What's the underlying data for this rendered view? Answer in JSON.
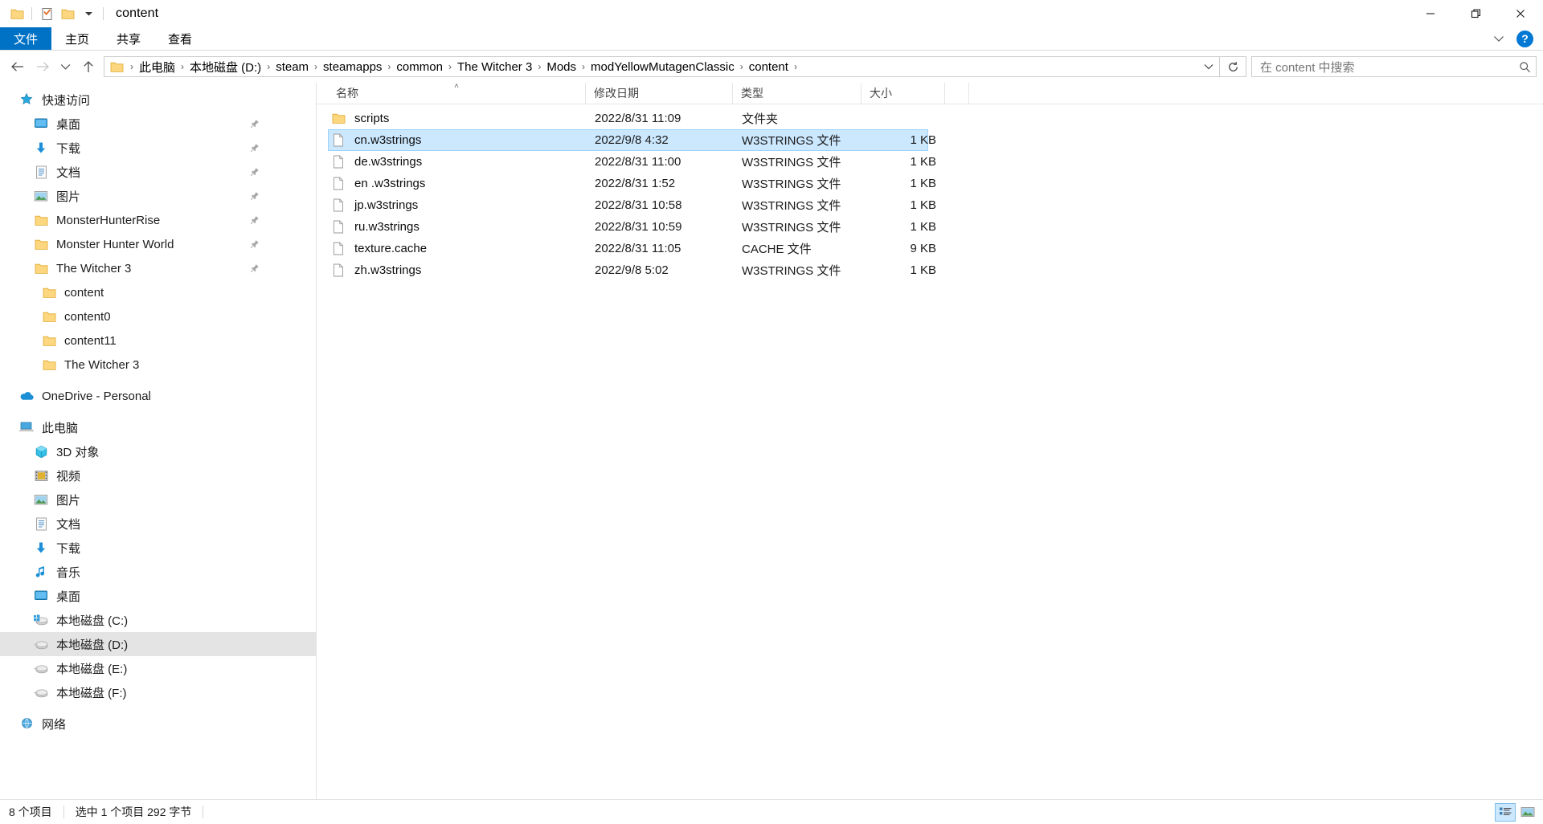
{
  "window": {
    "title": "content",
    "quick_access": [
      {
        "name": "folder-icon",
        "label": "文件夹"
      },
      {
        "name": "properties-icon",
        "label": "属性"
      },
      {
        "name": "new-folder-icon",
        "label": "新建文件夹"
      }
    ],
    "controls": {
      "minimize": "—",
      "maximize": "❐",
      "close": "✕"
    }
  },
  "ribbon": {
    "tabs": [
      {
        "label": "文件",
        "active": true
      },
      {
        "label": "主页",
        "active": false
      },
      {
        "label": "共享",
        "active": false
      },
      {
        "label": "查看",
        "active": false
      }
    ],
    "collapse_label": "展开功能区",
    "help_label": "?"
  },
  "address": {
    "back_label": "返回",
    "forward_label": "前进",
    "recent_label": "最近位置",
    "up_label": "上移",
    "breadcrumbs": [
      "此电脑",
      "本地磁盘 (D:)",
      "steam",
      "steamapps",
      "common",
      "The Witcher 3",
      "Mods",
      "modYellowMutagenClassic",
      "content"
    ],
    "separator": "›",
    "refresh_label": "刷新",
    "dropdown_label": "下拉"
  },
  "search": {
    "placeholder": "在 content 中搜索",
    "value": ""
  },
  "sidebar": {
    "groups": [
      {
        "header": {
          "label": "快速访问",
          "icon": "star-icon",
          "level": 0
        },
        "items": [
          {
            "label": "桌面",
            "icon": "desktop-icon",
            "level": 1,
            "pinned": true
          },
          {
            "label": "下载",
            "icon": "download-icon",
            "level": 1,
            "pinned": true
          },
          {
            "label": "文档",
            "icon": "documents-icon",
            "level": 1,
            "pinned": true
          },
          {
            "label": "图片",
            "icon": "pictures-icon",
            "level": 1,
            "pinned": true
          },
          {
            "label": "MonsterHunterRise",
            "icon": "folder-icon",
            "level": 1,
            "pinned": true
          },
          {
            "label": "Monster Hunter World",
            "icon": "folder-icon",
            "level": 1,
            "pinned": true
          },
          {
            "label": "The Witcher 3",
            "icon": "folder-icon",
            "level": 1,
            "pinned": true
          },
          {
            "label": "content",
            "icon": "folder-icon",
            "level": 2,
            "pinned": false
          },
          {
            "label": "content0",
            "icon": "folder-icon",
            "level": 2,
            "pinned": false
          },
          {
            "label": "content11",
            "icon": "folder-icon",
            "level": 2,
            "pinned": false
          },
          {
            "label": "The Witcher 3",
            "icon": "folder-icon",
            "level": 2,
            "pinned": false
          }
        ]
      },
      {
        "header": {
          "label": "OneDrive - Personal",
          "icon": "onedrive-icon",
          "level": 0
        },
        "items": []
      },
      {
        "header": {
          "label": "此电脑",
          "icon": "thispc-icon",
          "level": 0
        },
        "items": [
          {
            "label": "3D 对象",
            "icon": "3dobjects-icon",
            "level": 1,
            "pinned": false
          },
          {
            "label": "视频",
            "icon": "videos-icon",
            "level": 1,
            "pinned": false
          },
          {
            "label": "图片",
            "icon": "pictures-icon",
            "level": 1,
            "pinned": false
          },
          {
            "label": "文档",
            "icon": "documents-icon",
            "level": 1,
            "pinned": false
          },
          {
            "label": "下载",
            "icon": "download-icon",
            "level": 1,
            "pinned": false
          },
          {
            "label": "音乐",
            "icon": "music-icon",
            "level": 1,
            "pinned": false
          },
          {
            "label": "桌面",
            "icon": "desktop-icon",
            "level": 1,
            "pinned": false
          },
          {
            "label": "本地磁盘 (C:)",
            "icon": "windows-drive-icon",
            "level": 1,
            "pinned": false
          },
          {
            "label": "本地磁盘 (D:)",
            "icon": "drive-icon",
            "level": 1,
            "pinned": false,
            "selected": true
          },
          {
            "label": "本地磁盘 (E:)",
            "icon": "drive-icon",
            "level": 1,
            "pinned": false
          },
          {
            "label": "本地磁盘 (F:)",
            "icon": "drive-icon",
            "level": 1,
            "pinned": false
          }
        ]
      },
      {
        "header": {
          "label": "网络",
          "icon": "network-icon",
          "level": 0
        },
        "items": []
      }
    ]
  },
  "filelist": {
    "columns": [
      {
        "key": "name",
        "label": "名称",
        "sorted": "asc"
      },
      {
        "key": "date",
        "label": "修改日期",
        "sorted": ""
      },
      {
        "key": "type",
        "label": "类型",
        "sorted": ""
      },
      {
        "key": "size",
        "label": "大小",
        "sorted": ""
      }
    ],
    "sort_caret": "˄",
    "rows": [
      {
        "name": "scripts",
        "date": "2022/8/31 11:09",
        "type": "文件夹",
        "size": "",
        "icon": "folder-icon",
        "selected": false
      },
      {
        "name": "cn.w3strings",
        "date": "2022/9/8 4:32",
        "type": "W3STRINGS 文件",
        "size": "1 KB",
        "icon": "file-icon",
        "selected": true
      },
      {
        "name": "de.w3strings",
        "date": "2022/8/31 11:00",
        "type": "W3STRINGS 文件",
        "size": "1 KB",
        "icon": "file-icon",
        "selected": false
      },
      {
        "name": "en .w3strings",
        "date": "2022/8/31 1:52",
        "type": "W3STRINGS 文件",
        "size": "1 KB",
        "icon": "file-icon",
        "selected": false
      },
      {
        "name": "jp.w3strings",
        "date": "2022/8/31 10:58",
        "type": "W3STRINGS 文件",
        "size": "1 KB",
        "icon": "file-icon",
        "selected": false
      },
      {
        "name": "ru.w3strings",
        "date": "2022/8/31 10:59",
        "type": "W3STRINGS 文件",
        "size": "1 KB",
        "icon": "file-icon",
        "selected": false
      },
      {
        "name": "texture.cache",
        "date": "2022/8/31 11:05",
        "type": "CACHE 文件",
        "size": "9 KB",
        "icon": "file-icon",
        "selected": false
      },
      {
        "name": "zh.w3strings",
        "date": "2022/9/8 5:02",
        "type": "W3STRINGS 文件",
        "size": "1 KB",
        "icon": "file-icon",
        "selected": false
      }
    ]
  },
  "status": {
    "count": "8 个项目",
    "selection": "选中 1 个项目  292 字节",
    "views": [
      {
        "name": "details-view",
        "active": true
      },
      {
        "name": "large-icons-view",
        "active": false
      }
    ]
  },
  "colors": {
    "accent": "#0072c6",
    "selection": "#cce8ff",
    "selection_border": "#99d1ff",
    "nav_selected": "#e4e4e4",
    "folder": "#ffd04b",
    "help": "#0078d4"
  }
}
